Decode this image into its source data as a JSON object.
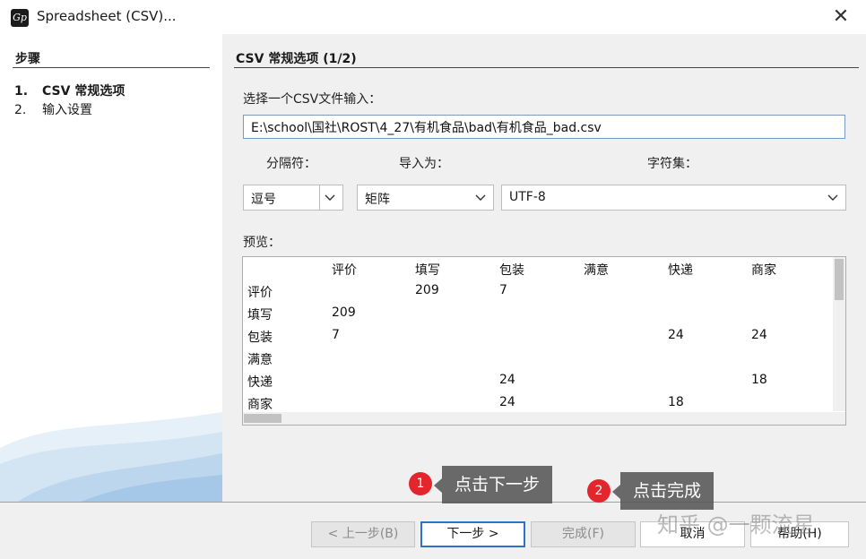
{
  "window": {
    "title": "Spreadsheet (CSV)...",
    "icon_glyph": "Gp",
    "close_glyph": "✕"
  },
  "sidebar": {
    "heading": "步骤",
    "steps": [
      {
        "num": "1.",
        "label": "CSV 常规选项",
        "active": true
      },
      {
        "num": "2.",
        "label": "输入设置",
        "active": false
      }
    ]
  },
  "main": {
    "title": "CSV 常规选项 (1/2)",
    "file_label": "选择一个CSV文件输入：",
    "file_value": "E:\\school\\国社\\ROST\\4_27\\有机食品\\bad\\有机食品_bad.csv",
    "separator": {
      "label": "分隔符：",
      "value": "逗号"
    },
    "import_as": {
      "label": "导入为：",
      "value": "矩阵"
    },
    "charset": {
      "label": "字符集：",
      "value": "UTF-8"
    },
    "preview_label": "预览：",
    "preview": {
      "columns": [
        "",
        "评价",
        "填写",
        "包装",
        "满意",
        "快递",
        "商家"
      ],
      "rows": [
        [
          "评价",
          "",
          "209",
          "7",
          "",
          "",
          ""
        ],
        [
          "填写",
          "209",
          "",
          "",
          "",
          "",
          ""
        ],
        [
          "包装",
          "7",
          "",
          "",
          "",
          "24",
          "24"
        ],
        [
          "满意",
          "",
          "",
          "",
          "",
          "",
          ""
        ],
        [
          "快递",
          "",
          "",
          "24",
          "",
          "",
          "18"
        ],
        [
          "商家",
          "",
          "",
          "24",
          "",
          "18",
          ""
        ]
      ]
    }
  },
  "footer": {
    "back": "< 上一步(B)",
    "next": "下一步 >",
    "finish": "完成(F)",
    "cancel": "取消",
    "help": "帮助(H)"
  },
  "annotations": {
    "step1": {
      "num": "1",
      "text": "点击下一步"
    },
    "step2": {
      "num": "2",
      "text": "点击完成"
    }
  },
  "watermark": "知乎 @一颗流星",
  "colors": {
    "accent": "#2c73c8",
    "callout_dot": "#e3262d",
    "panel_bg": "#f0f0f0"
  }
}
